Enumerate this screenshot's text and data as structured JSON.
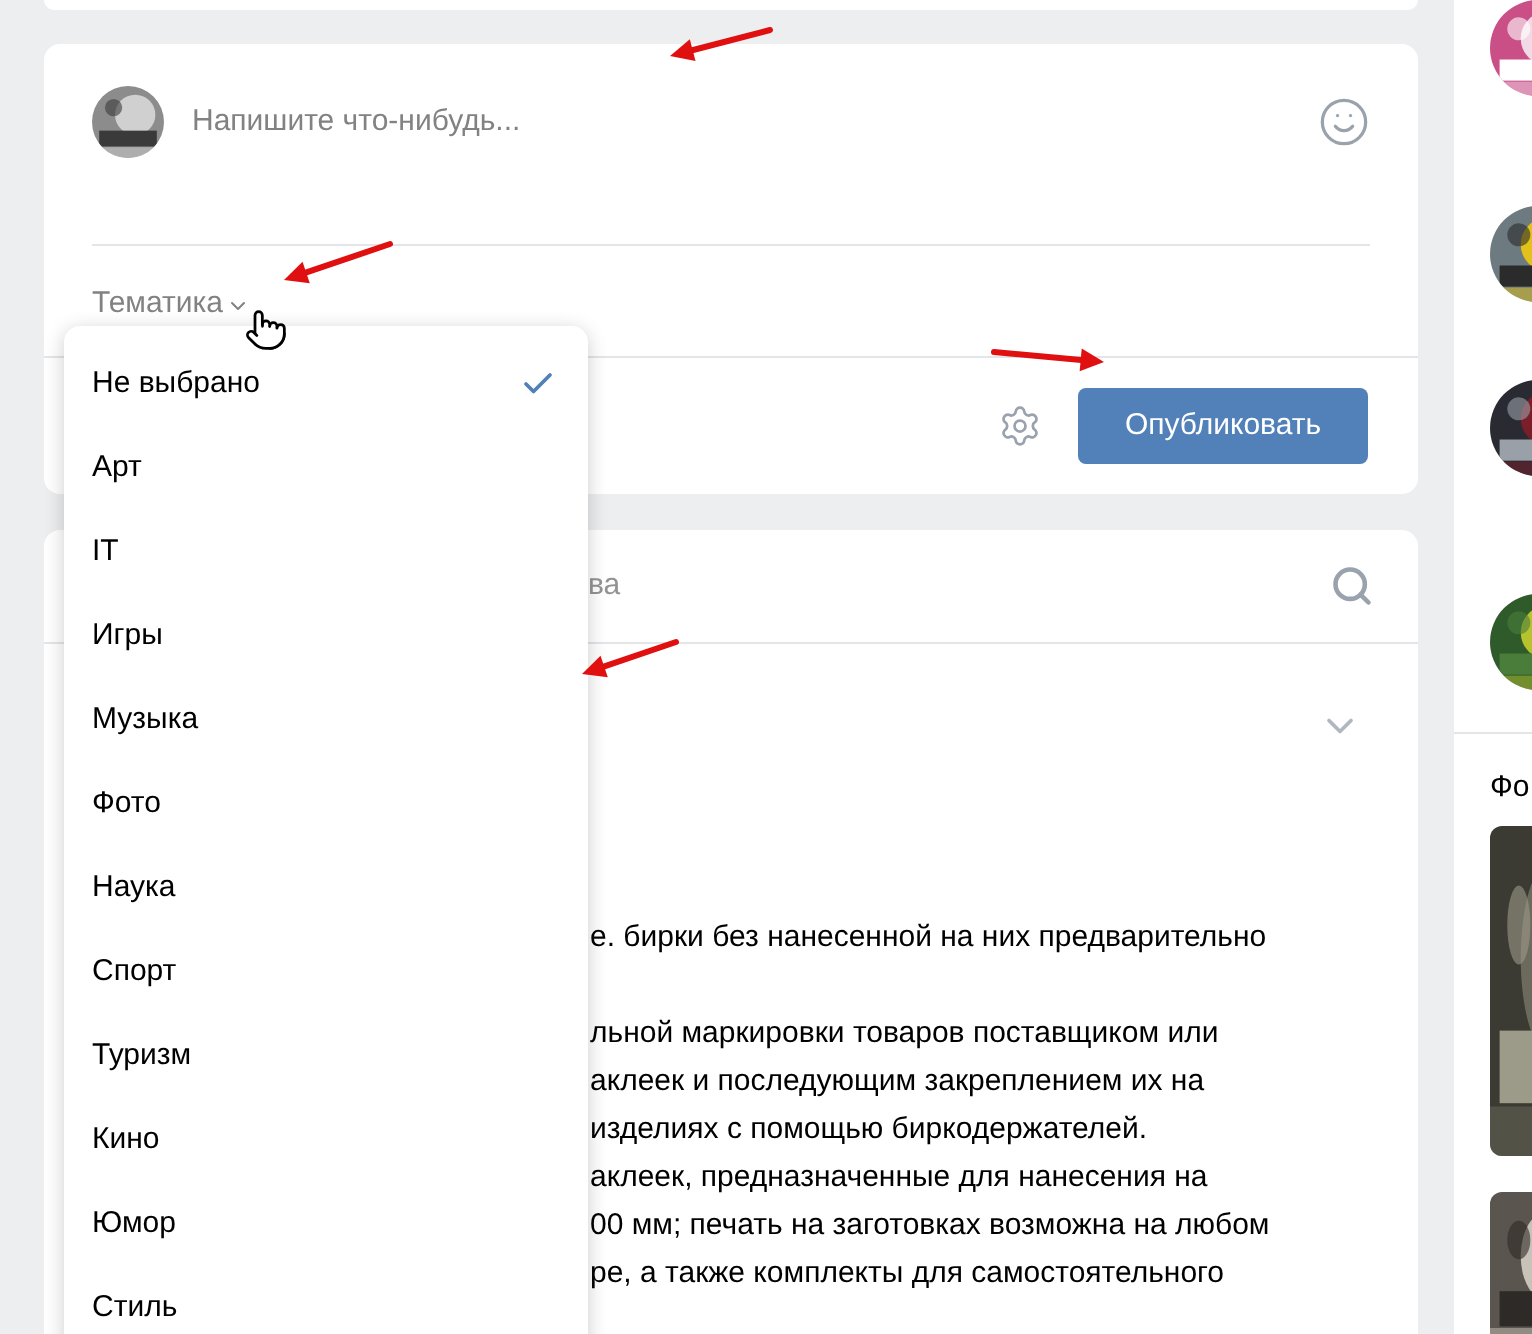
{
  "composer": {
    "placeholder": "Напишите что-нибудь...",
    "topic_label": "Тематика",
    "publish_button": "Опубликовать"
  },
  "topic_menu": [
    {
      "label": "Не выбрано",
      "selected": true
    },
    {
      "label": "Арт",
      "selected": false
    },
    {
      "label": "IT",
      "selected": false
    },
    {
      "label": "Игры",
      "selected": false
    },
    {
      "label": "Музыка",
      "selected": false
    },
    {
      "label": "Фото",
      "selected": false
    },
    {
      "label": "Наука",
      "selected": false
    },
    {
      "label": "Спорт",
      "selected": false
    },
    {
      "label": "Туризм",
      "selected": false
    },
    {
      "label": "Кино",
      "selected": false
    },
    {
      "label": "Юмор",
      "selected": false
    },
    {
      "label": "Стиль",
      "selected": false
    }
  ],
  "search": {
    "placeholder": "ва"
  },
  "post_paragraphs": [
    [
      "е. бирки без нанесенной на них предварительно"
    ],
    [
      "льной маркировки товаров поставщиком или",
      "аклеек и последующим закреплением их на",
      "изделиях с помощью биркодержателей.",
      "аклеек, предназначенные для нанесения на",
      "00 мм; печать на заготовках возможна на любом",
      "ре, а также комплекты для самостоятельного"
    ]
  ],
  "sidebar": {
    "heading": "Фо"
  }
}
